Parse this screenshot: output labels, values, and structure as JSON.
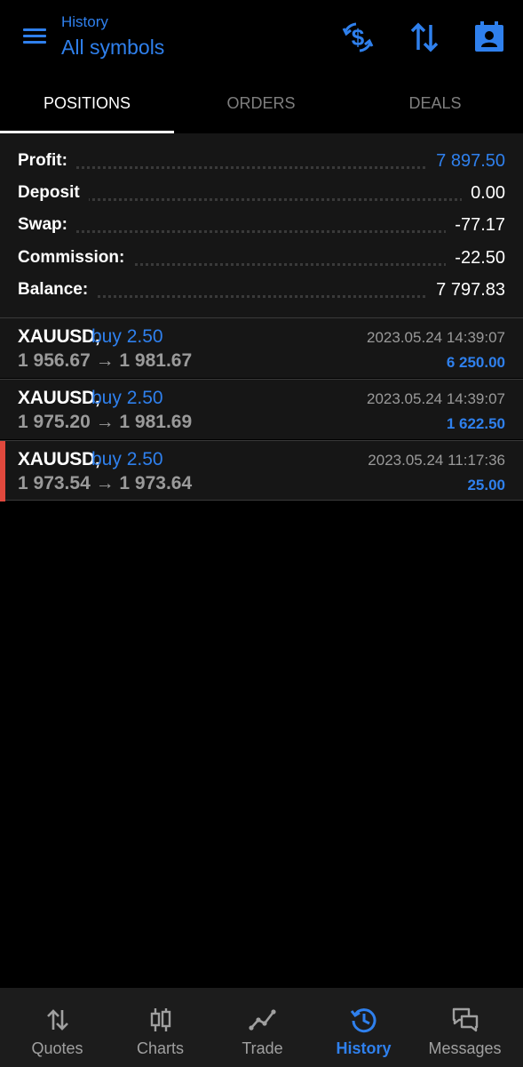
{
  "header": {
    "subtitle": "History",
    "title": "All symbols",
    "accent": "#2f80ed",
    "icons": [
      "menu-icon",
      "currency-exchange-icon",
      "sort-icon",
      "calendar-contact-icon"
    ]
  },
  "tabs": [
    {
      "label": "POSITIONS",
      "active": true
    },
    {
      "label": "ORDERS",
      "active": false
    },
    {
      "label": "DEALS",
      "active": false
    }
  ],
  "summary": {
    "profit": {
      "label": "Profit:",
      "value": "7 897.50"
    },
    "deposit": {
      "label": "Deposit",
      "value": "0.00"
    },
    "swap": {
      "label": "Swap:",
      "value": "-77.17"
    },
    "commission": {
      "label": "Commission:",
      "value": "-22.50"
    },
    "balance": {
      "label": "Balance:",
      "value": "7 797.83"
    }
  },
  "deals": [
    {
      "symbol": "XAUUSD,",
      "type": "buy 2.50",
      "prices": "1 956.67 → 1 981.67",
      "time": "2023.05.24 14:39:07",
      "profit": "6 250.00"
    },
    {
      "symbol": "XAUUSD,",
      "type": "buy 2.50",
      "prices": "1 975.20 → 1 981.69",
      "time": "2023.05.24 14:39:07",
      "profit": "1 622.50"
    },
    {
      "symbol": "XAUUSD,",
      "type": "buy 2.50",
      "prices": "1 973.54 → 1 973.64",
      "time": "2023.05.24 11:17:36",
      "profit": "25.00",
      "marker_color": "#e0483d"
    }
  ],
  "nav": [
    {
      "label": "Quotes",
      "icon": "quotes-icon"
    },
    {
      "label": "Charts",
      "icon": "charts-icon"
    },
    {
      "label": "Trade",
      "icon": "trade-icon"
    },
    {
      "label": "History",
      "icon": "history-icon",
      "active": true
    },
    {
      "label": "Messages",
      "icon": "messages-icon"
    }
  ]
}
